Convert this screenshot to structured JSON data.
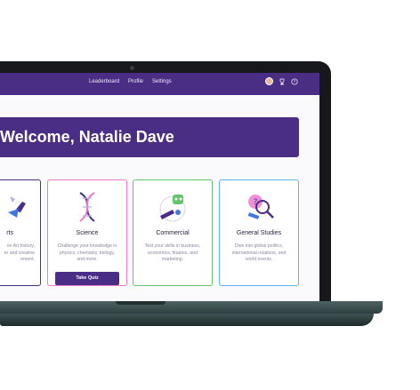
{
  "nav": {
    "links": [
      "Leaderboard",
      "Profile",
      "Settings"
    ],
    "icons": [
      "avatar",
      "trophy-icon",
      "help-icon"
    ]
  },
  "banner": {
    "title": "Welcome, Natalie Dave"
  },
  "cards": [
    {
      "title": "rts",
      "desc": "on Art history,\ner and creative\nement.",
      "border": "#4a2d84"
    },
    {
      "title": "Science",
      "desc": "Challenge your knowledge in\nphysics, chemistry, biology,\nand more.",
      "border": "#f07ad1",
      "button": "Take Quiz"
    },
    {
      "title": "Commercial",
      "desc": "Test your skills in business,\neconomics, finance, and\nmarketing.",
      "border": "#64c46b"
    },
    {
      "title": "General Studies",
      "desc": "Dive into global politics,\ninternational relations, and\nworld events.",
      "border": "#5fb3ee"
    }
  ],
  "colors": {
    "brand": "#4a2d84",
    "pink": "#f07ad1",
    "green": "#64c46b",
    "blue": "#5fb3ee"
  }
}
